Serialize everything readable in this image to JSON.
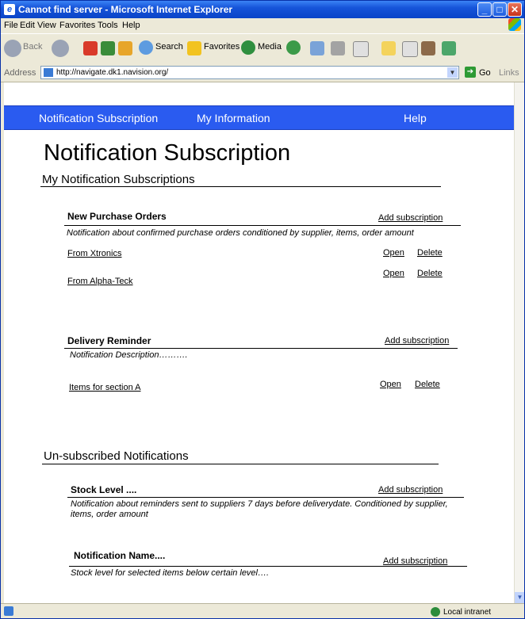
{
  "window": {
    "title": "Cannot find server - Microsoft Internet Explorer"
  },
  "menu": [
    "File",
    "Edit",
    "View",
    "Favorites",
    "Tools",
    "Help"
  ],
  "toolbar": {
    "back": "Back",
    "search": "Search",
    "favorites": "Favorites",
    "media": "Media"
  },
  "address": {
    "label": "Address",
    "url": "http://navigate.dk1.navision.org/",
    "go": "Go",
    "links": "Links"
  },
  "nav": {
    "items": [
      "Notification Subscription",
      "My Information",
      "Help"
    ]
  },
  "page": {
    "title": "Notification Subscription",
    "subscriptions_heading": "My Notification Subscriptions",
    "unsubscribed_heading": "Un-subscribed Notifications"
  },
  "subscribed": [
    {
      "name": "New Purchase Orders",
      "add": "Add subscription",
      "description": "Notification about confirmed purchase orders conditioned by supplier, items, order amount",
      "items": [
        {
          "label": "From Xtronics",
          "open": "Open",
          "delete": "Delete"
        },
        {
          "label": "From Alpha-Teck",
          "open": "Open",
          "delete": "Delete"
        }
      ]
    },
    {
      "name": "Delivery Reminder",
      "add": "Add subscription",
      "description": "Notification Description……….",
      "items": [
        {
          "label": "Items for section A",
          "open": "Open",
          "delete": "Delete"
        }
      ]
    }
  ],
  "unsubscribed": [
    {
      "name": "Stock Level ....",
      "add": "Add subscription",
      "description": "Notification about reminders sent to suppliers 7 days before deliverydate. Conditioned by supplier, items, order amount"
    },
    {
      "name": "Notification Name....",
      "add": "Add subscription",
      "description": "Stock level for selected  items below certain level…."
    }
  ],
  "status": {
    "zone": "Local intranet"
  }
}
